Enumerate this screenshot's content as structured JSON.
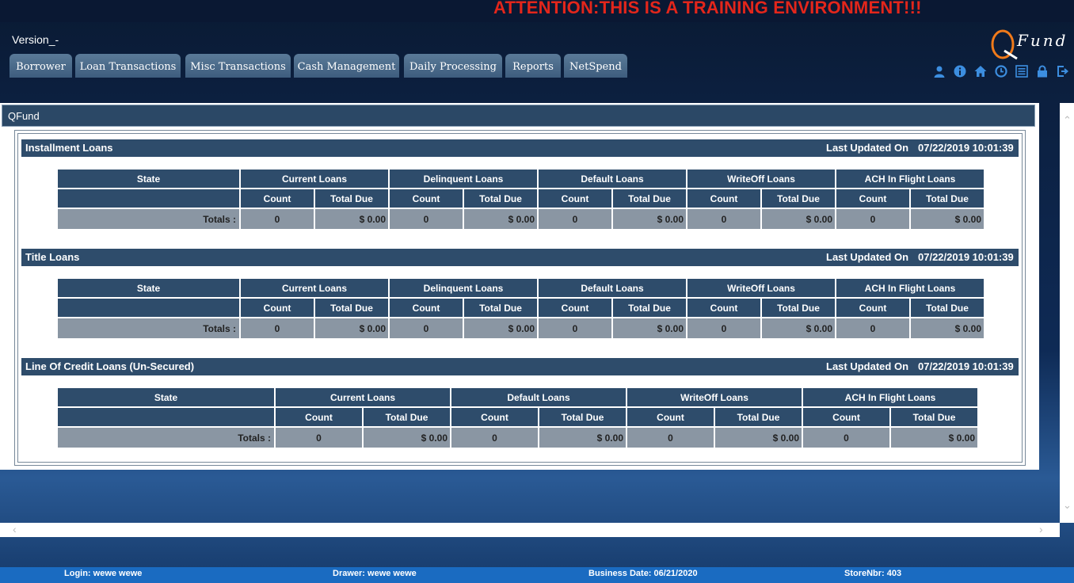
{
  "banner": "ATTENTION:THIS IS A TRAINING ENVIRONMENT!!!",
  "version": "Version_-",
  "logo_text": "Fund",
  "tabs": [
    "Borrower",
    "Loan Transactions",
    "Misc Transactions",
    "Cash Management",
    "Daily Processing",
    "Reports",
    "NetSpend"
  ],
  "toolbar_icons": [
    "user-icon",
    "info-icon",
    "home-icon",
    "clock-icon",
    "list-icon",
    "lock-icon",
    "logout-icon"
  ],
  "pane_title": "QFund",
  "sections": [
    {
      "title": "Installment Loans",
      "updated_label": "Last Updated On",
      "updated_value": "07/22/2019 10:01:39",
      "state_header": "State",
      "groups": [
        "Current Loans",
        "Delinquent Loans",
        "Default Loans",
        "WriteOff Loans",
        "ACH In Flight Loans"
      ],
      "sub_headers": [
        "Count",
        "Total Due"
      ],
      "totals_label": "Totals :",
      "totals": [
        "0",
        "$ 0.00",
        "0",
        "$ 0.00",
        "0",
        "$ 0.00",
        "0",
        "$ 0.00",
        "0",
        "$ 0.00"
      ]
    },
    {
      "title": "Title Loans",
      "updated_label": "Last Updated On",
      "updated_value": "07/22/2019 10:01:39",
      "state_header": "State",
      "groups": [
        "Current Loans",
        "Delinquent Loans",
        "Default Loans",
        "WriteOff Loans",
        "ACH In Flight Loans"
      ],
      "sub_headers": [
        "Count",
        "Total Due"
      ],
      "totals_label": "Totals :",
      "totals": [
        "0",
        "$ 0.00",
        "0",
        "$ 0.00",
        "0",
        "$ 0.00",
        "0",
        "$ 0.00",
        "0",
        "$ 0.00"
      ]
    },
    {
      "title": "Line Of Credit Loans (Un-Secured)",
      "updated_label": "Last Updated On",
      "updated_value": "07/22/2019 10:01:39",
      "state_header": "State",
      "groups": [
        "Current Loans",
        "Default Loans",
        "WriteOff Loans",
        "ACH In Flight Loans"
      ],
      "sub_headers": [
        "Count",
        "Total Due"
      ],
      "totals_label": "Totals :",
      "totals": [
        "0",
        "$ 0.00",
        "0",
        "$ 0.00",
        "0",
        "$ 0.00",
        "0",
        "$ 0.00"
      ]
    }
  ],
  "status": {
    "login": "Login: wewe wewe",
    "drawer": "Drawer: wewe wewe",
    "business_date": "Business Date: 06/21/2020",
    "store": "StoreNbr: 403"
  },
  "colors": {
    "banner_text": "#e3261b",
    "header_bg": "#2e4c6b",
    "totals_bg": "#8a96a3",
    "status_bar": "#1a6bc1"
  }
}
